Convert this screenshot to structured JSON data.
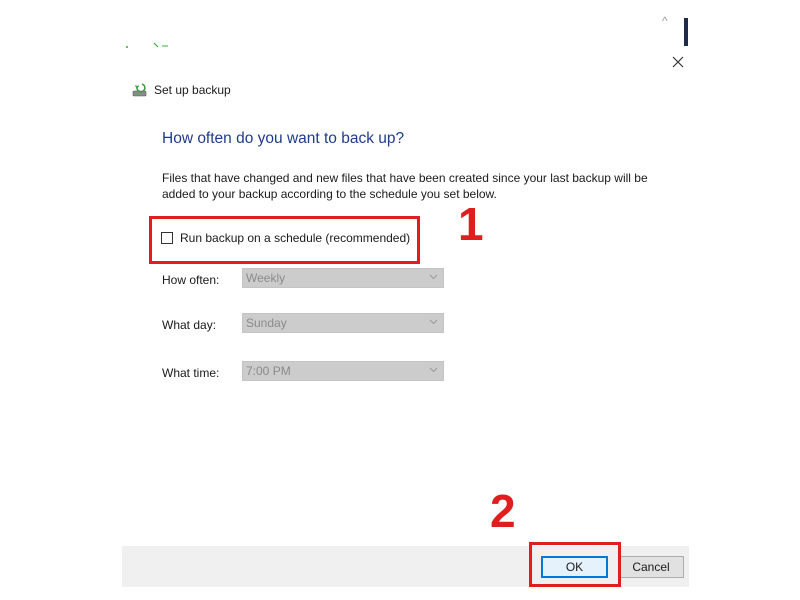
{
  "window": {
    "title": "Set up backup",
    "close_glyph": "✕",
    "icon": "backup-disk-icon"
  },
  "main": {
    "heading": "How often do you want to back up?",
    "description": "Files that have changed and new files that have been created since your last backup will be added to your backup according to the schedule you set below.",
    "schedule_checkbox": {
      "label": "Run backup on a schedule (recommended)",
      "checked": false
    },
    "fields": [
      {
        "label": "How often:",
        "value": "Weekly",
        "enabled": false
      },
      {
        "label": "What day:",
        "value": "Sunday",
        "enabled": false
      },
      {
        "label": "What time:",
        "value": "7:00 PM",
        "enabled": false
      }
    ]
  },
  "footer": {
    "ok_label": "OK",
    "cancel_label": "Cancel"
  },
  "annotations": {
    "step1": "1",
    "step2": "2",
    "highlight_color": "#e01e1e"
  },
  "colors": {
    "heading": "#1e3c8c",
    "disabled_field": "#cccccc",
    "footer_bg": "#f0f0f0",
    "ok_border": "#0078d7"
  }
}
